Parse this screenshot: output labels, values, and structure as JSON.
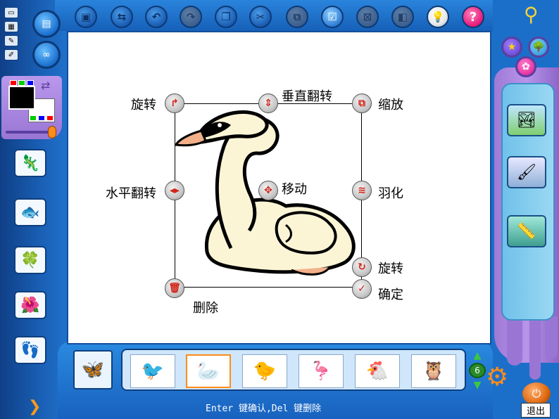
{
  "toolbar": {
    "buttons": [
      {
        "name": "new-icon",
        "glyph": "▣"
      },
      {
        "name": "open-icon",
        "glyph": "⇆"
      },
      {
        "name": "undo-icon",
        "glyph": "↶"
      },
      {
        "name": "redo-icon",
        "glyph": "↷"
      },
      {
        "name": "copy-icon",
        "glyph": "❐"
      },
      {
        "name": "cut-icon",
        "glyph": "✂"
      },
      {
        "name": "paste-icon",
        "glyph": "⧉"
      },
      {
        "name": "check-icon",
        "glyph": "☑"
      },
      {
        "name": "close-box-icon",
        "glyph": "⊠"
      },
      {
        "name": "layers-icon",
        "glyph": "◧"
      }
    ],
    "bulb_glyph": "💡",
    "help_glyph": "?"
  },
  "left_rail": {
    "mini_icons": [
      "▭",
      "▦",
      "✎",
      "✐"
    ],
    "round_btn_1": "▤",
    "round_btn_2": "∞",
    "swatch_colors": [
      "#ff0000",
      "#00cc00",
      "#0000ff"
    ],
    "swatch_colors_2": [
      "#00cc00",
      "#0000ff",
      "#ff0000"
    ],
    "stamps": [
      {
        "name": "lizard-stamp-icon",
        "glyph": "🦎"
      },
      {
        "name": "fish-stamp-icon",
        "glyph": "🐟"
      },
      {
        "name": "leaf-stamp-icon",
        "glyph": "🍀"
      },
      {
        "name": "flower-stamp-icon",
        "glyph": "🌺"
      },
      {
        "name": "footprint-stamp-icon",
        "glyph": "👣"
      }
    ],
    "nav_arrow": "❯"
  },
  "canvas": {
    "labels": {
      "rotate_top": "旋转",
      "flip_vertical": "垂直翻转",
      "scale": "缩放",
      "flip_horizontal": "水平翻转",
      "move": "移动",
      "feather": "羽化",
      "rotate_bottom": "旋转",
      "confirm": "确定",
      "delete": "删除"
    },
    "handle_glyphs": {
      "rotate_top": "↱",
      "flip_vertical": "⇕",
      "scale": "⧉",
      "flip_horizontal": "◂▸",
      "move": "✥",
      "feather": "≋",
      "rotate_bottom": "↻",
      "confirm": "✓",
      "delete": "🗑"
    }
  },
  "bottom": {
    "category_glyph": "🦋",
    "stamps": [
      {
        "name": "swallow-stamp",
        "glyph": "🐦"
      },
      {
        "name": "swan-stamp",
        "glyph": "🦢"
      },
      {
        "name": "redbird-stamp",
        "glyph": "🐤"
      },
      {
        "name": "ostrich-stamp",
        "glyph": "🦩"
      },
      {
        "name": "hen-stamp",
        "glyph": "🐔"
      },
      {
        "name": "owl-stamp",
        "glyph": "🦉"
      }
    ],
    "selected_index": 1,
    "page_up": "▲",
    "page_number": "6",
    "page_down": "▼",
    "status": "Enter 键确认,Del 键删除"
  },
  "right_panel": {
    "star_glyph": "★",
    "tree_glyph": "🌳",
    "flower_glyph": "✿",
    "tools": [
      {
        "name": "landscape-tool-icon",
        "glyph": "🏞"
      },
      {
        "name": "brush-tool-icon",
        "glyph": "🖌"
      },
      {
        "name": "ruler-tool-icon",
        "glyph": "📏"
      }
    ],
    "gear_glyph": "⚙",
    "power_glyph": "⏻",
    "exit_label": "退出",
    "wrench_glyph": "⚲"
  }
}
